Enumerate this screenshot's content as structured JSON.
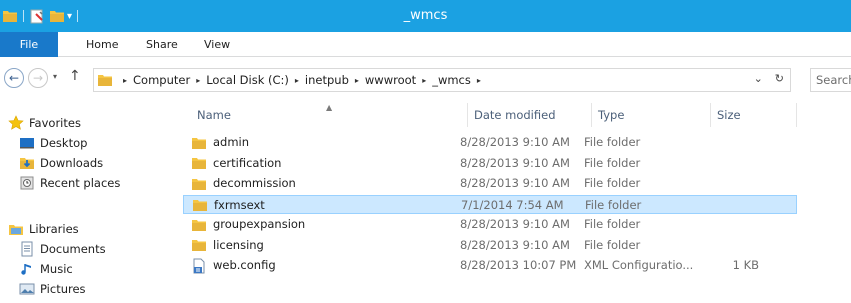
{
  "window": {
    "title": "_wmcs"
  },
  "qat": {
    "dropdown_glyph": "▾"
  },
  "ribbon": {
    "tabs": [
      "File",
      "Home",
      "Share",
      "View"
    ]
  },
  "nav": {
    "back_glyph": "←",
    "forward_glyph": "→",
    "recent_glyph": "▾",
    "up_glyph": "↑"
  },
  "address": {
    "crumbs": [
      "Computer",
      "Local Disk (C:)",
      "inetpub",
      "wwwroot",
      "_wmcs"
    ],
    "separator": "▸",
    "history_glyph": "⌄",
    "refresh_glyph": "↻"
  },
  "search": {
    "placeholder": "Search"
  },
  "navpane": {
    "favorites": {
      "label": "Favorites",
      "items": [
        "Desktop",
        "Downloads",
        "Recent places"
      ]
    },
    "libraries": {
      "label": "Libraries",
      "items": [
        "Documents",
        "Music",
        "Pictures"
      ]
    }
  },
  "columns": {
    "name": "Name",
    "date": "Date modified",
    "type": "Type",
    "size": "Size",
    "sort_glyph": "▲"
  },
  "files": [
    {
      "name": "admin",
      "date": "8/28/2013 9:10 AM",
      "type": "File folder",
      "size": "",
      "icon": "folder-icon"
    },
    {
      "name": "certification",
      "date": "8/28/2013 9:10 AM",
      "type": "File folder",
      "size": "",
      "icon": "folder-icon"
    },
    {
      "name": "decommission",
      "date": "8/28/2013 9:10 AM",
      "type": "File folder",
      "size": "",
      "icon": "folder-icon"
    },
    {
      "name": "fxrmsext",
      "date": "7/1/2014 7:54 AM",
      "type": "File folder",
      "size": "",
      "icon": "folder-icon",
      "selected": true
    },
    {
      "name": "groupexpansion",
      "date": "8/28/2013 9:10 AM",
      "type": "File folder",
      "size": "",
      "icon": "folder-icon"
    },
    {
      "name": "licensing",
      "date": "8/28/2013 9:10 AM",
      "type": "File folder",
      "size": "",
      "icon": "folder-icon"
    },
    {
      "name": "web.config",
      "date": "8/28/2013 10:07 PM",
      "type": "XML Configuratio...",
      "size": "1 KB",
      "icon": "config-file-icon"
    }
  ],
  "colors": {
    "titlebar": "#1ba1e2",
    "file_tab": "#1979ca",
    "selection_fill": "#cce8ff",
    "selection_border": "#99d1ff",
    "folder": "#e8b53a"
  }
}
